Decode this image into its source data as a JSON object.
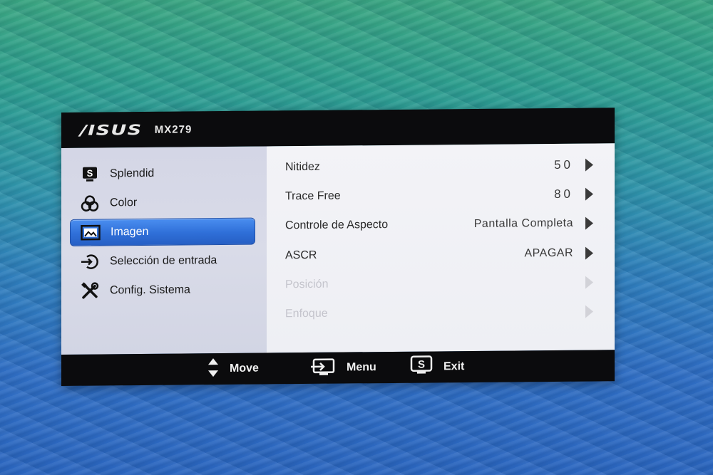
{
  "header": {
    "brand": "/ISUS",
    "model": "MX279"
  },
  "sidebar": {
    "items": [
      {
        "label": "Splendid",
        "icon": "splendid-s-icon",
        "selected": false
      },
      {
        "label": "Color",
        "icon": "color-circles-icon",
        "selected": false
      },
      {
        "label": "Imagen",
        "icon": "image-icon",
        "selected": true
      },
      {
        "label": "Selección de entrada",
        "icon": "input-select-icon",
        "selected": false
      },
      {
        "label": "Config. Sistema",
        "icon": "tools-icon",
        "selected": false
      }
    ]
  },
  "settings": {
    "rows": [
      {
        "label": "Nitidez",
        "value": "50",
        "enabled": true
      },
      {
        "label": "Trace Free",
        "value": "80",
        "enabled": true
      },
      {
        "label": "Controle de Aspecto",
        "value": "Pantalla Completa",
        "enabled": true
      },
      {
        "label": "ASCR",
        "value": "APAGAR",
        "enabled": true
      },
      {
        "label": "Posición",
        "value": "",
        "enabled": false
      },
      {
        "label": "Enfoque",
        "value": "",
        "enabled": false
      }
    ]
  },
  "footer": {
    "move_label": "Move",
    "menu_label": "Menu",
    "exit_label": "Exit",
    "move_icon": "up-down-arrows-icon",
    "menu_icon": "menu-enter-icon",
    "exit_icon": "s-button-icon"
  },
  "colors": {
    "accent": "#2f6fd8",
    "titlebar": "#0b0b0d",
    "sidebar_bg": "#d6d8e6",
    "content_bg": "#f1f1f5"
  }
}
